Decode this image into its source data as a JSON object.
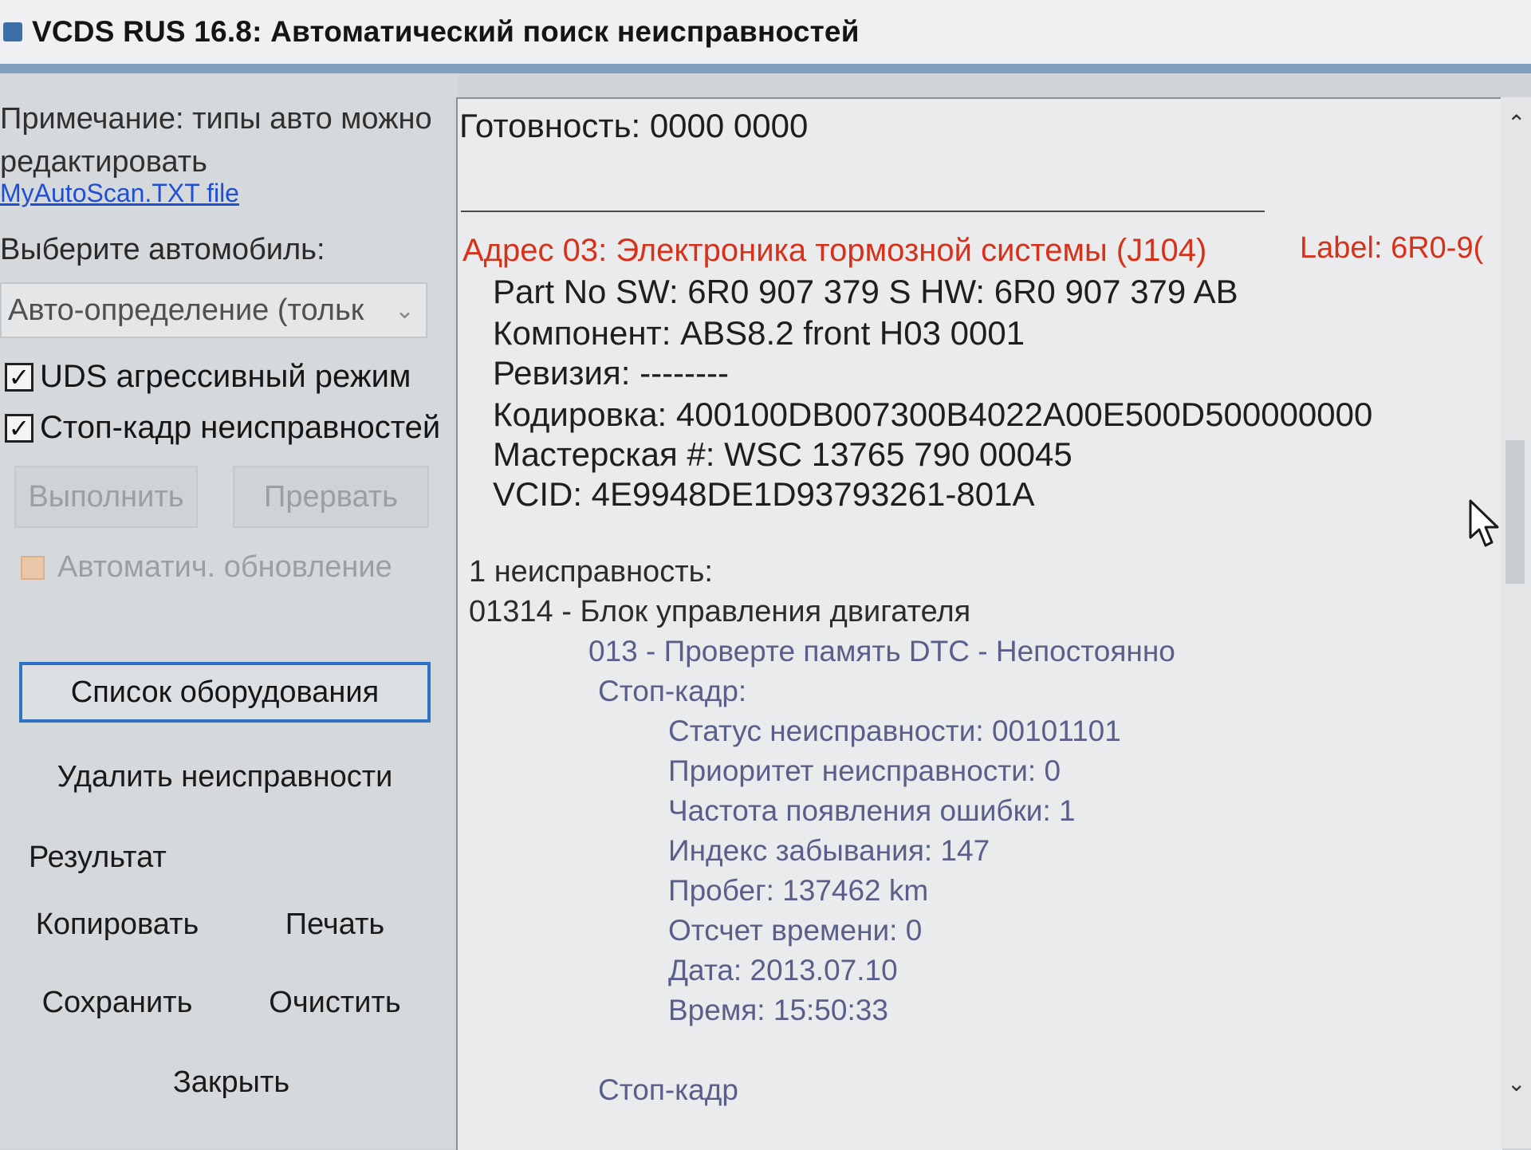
{
  "window": {
    "title": "VCDS RUS 16.8:  Автоматический поиск неисправностей"
  },
  "left": {
    "note": "Примечание: типы авто можно редактировать",
    "note_link": "MyAutoScan.TXT file",
    "select_label": "Выберите автомобиль:",
    "select_value": "Авто-определение (тольк",
    "checkbox_uds": {
      "label": "UDS агрессивный режим",
      "checked": true
    },
    "checkbox_freeze": {
      "label": "Стоп-кадр неисправностей",
      "checked": true
    },
    "run_button": "Выполнить",
    "abort_button": "Прервать",
    "auto_update_label": "Автоматич. обновление",
    "equipment_button": "Список оборудования",
    "clear_faults_button": "Удалить неисправности",
    "result_label": "Результат",
    "copy_button": "Копировать",
    "print_button": "Печать",
    "save_button": "Сохранить",
    "clear_button": "Очистить",
    "close_button": "Закрыть"
  },
  "output": {
    "readiness": "Готовность: 0000 0000",
    "address": "Адрес 03:  Электроника тормозной системы (J104)",
    "label": "Label: 6R0-9(",
    "part_no": "Part No SW: 6R0 907 379 S    HW: 6R0 907 379 AB",
    "component": "Компонент: ABS8.2 front  H03 0001",
    "revision": "Ревизия: --------",
    "coding": "Кодировка: 400100DB007300B4022A00E500D500000000",
    "workshop": "Мастерская #: WSC 13765 790 00045",
    "vcid": "VCID: 4E9948DE1D93793261-801A",
    "faults_count": "1 неисправность:",
    "fault_code": "01314 - Блок управления двигателя",
    "fault_detail": "013 - Проверте память DTC - Непостоянно",
    "freeze_frame": "Стоп-кадр:",
    "freeze": {
      "status": "Статус неисправности: 00101101",
      "priority": "Приоритет неисправности: 0",
      "frequency": "Частота появления ошибки: 1",
      "reset_index": "Индекс забывания: 147",
      "mileage": "Пробег: 137462 km",
      "time_ref": "Отсчет времени: 0",
      "date": "Дата: 2013.07.10",
      "time": "Время: 15:50:33"
    },
    "freeze_frame_2": "Стоп-кадр"
  },
  "icons": {
    "check": "✓",
    "chevron_down": "⌄",
    "scroll_up": "⌃",
    "scroll_down": "⌄"
  },
  "colors": {
    "address_red": "#d8311a",
    "focus_blue": "#2f73c6",
    "link_blue": "#1f4fd6",
    "freeze_text": "#5a5f8a"
  }
}
